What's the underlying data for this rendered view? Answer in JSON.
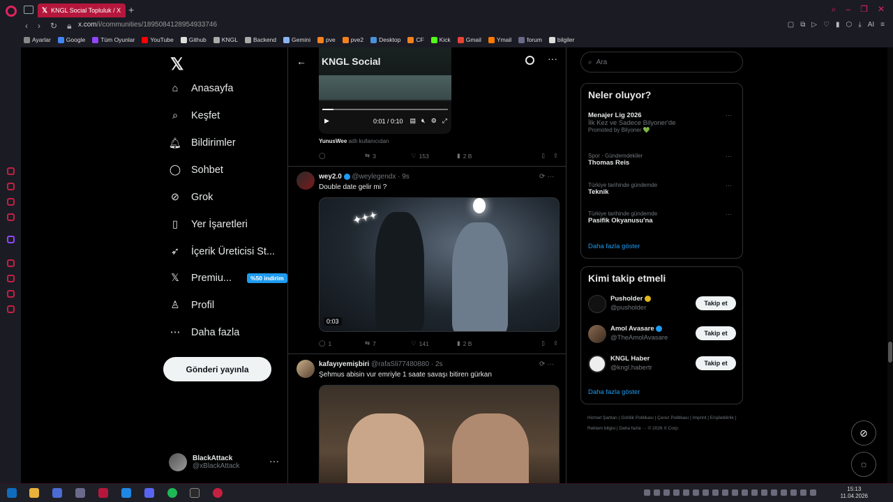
{
  "browser": {
    "tab_title": "KNGL Social Topluluk / X",
    "new_tab": "+",
    "url_host": "x.com",
    "url_path": "/i/communities/1895084128954933746",
    "bookmarks": [
      "Ayarlar",
      "Google",
      "Tüm Oyunlar",
      "YouTube",
      "Github",
      "KNGL",
      "Backend",
      "Gemini",
      "pve",
      "pve2",
      "Desktop",
      "CF",
      "Kick",
      "Gmail",
      "Ymail",
      "forum",
      "bilgiler"
    ],
    "ai_label": "AI"
  },
  "nav": {
    "items": [
      {
        "label": "Anasayfa",
        "icon": "home-icon"
      },
      {
        "label": "Keşfet",
        "icon": "search-icon"
      },
      {
        "label": "Bildirimler",
        "icon": "bell-icon"
      },
      {
        "label": "Sohbet",
        "icon": "chat-icon"
      },
      {
        "label": "Grok",
        "icon": "grok-icon"
      },
      {
        "label": "Yer İşaretleri",
        "icon": "bookmark-icon"
      },
      {
        "label": "İçerik Üreticisi St...",
        "icon": "rocket-icon"
      },
      {
        "label": "Premiu...",
        "icon": "x-logo-icon"
      },
      {
        "label": "Profil",
        "icon": "profile-icon"
      },
      {
        "label": "Daha fazla",
        "icon": "more-circle-icon"
      }
    ],
    "premium_badge": "%50 indirim",
    "post_button": "Gönderi yayınla",
    "account_name": "BlackAttack",
    "account_handle": "@xBlackAttack"
  },
  "feed": {
    "title": "KNGL Social",
    "first_video": {
      "time": "0:01 / 0:10",
      "note_user": "YunusWee",
      "note_text": "adlı kullanıcıdan"
    },
    "first_actions": {
      "replies": "",
      "reposts": "3",
      "likes": "153",
      "views": "2 B"
    },
    "tweets": [
      {
        "name": "wey2.0",
        "handle": "@weylegendx",
        "time": "9s",
        "text": "Double date gelir mi ?",
        "video_duration": "0:03",
        "replies": "1",
        "reposts": "7",
        "likes": "141",
        "views": "2 B"
      },
      {
        "name": "kafayıyemişbiri",
        "handle": "@rafaSli77480880",
        "time": "2s",
        "text": "Şehmus abisin vur emriyle 1 saate savaşı bitiren gürkan"
      }
    ]
  },
  "right": {
    "search_placeholder": "Ara",
    "trends_title": "Neler oluyor?",
    "trends": [
      {
        "category": "",
        "title": "Menajer Lig 2026",
        "subtitle": "İlk Kez ve Sadece Bilyoner'de",
        "promo": "Promoted by Bilyoner 💚"
      },
      {
        "category": "Spor · Gündemdekiler",
        "title": "Thomas Reis"
      },
      {
        "category": "Türkiye tarihinde gündemde",
        "title": "Teknik"
      },
      {
        "category": "Türkiye tarihinde gündemde",
        "title": "Pasifik Okyanusu'na"
      }
    ],
    "show_more": "Daha fazla göster",
    "follow_title": "Kimi takip etmeli",
    "follow": [
      {
        "name": "Pusholder",
        "handle": "@pusholder",
        "verified": "gold"
      },
      {
        "name": "Amol Avasare",
        "handle": "@TheAmolAvasare",
        "verified": "blue"
      },
      {
        "name": "KNGL Haber",
        "handle": "@kngl.habertr",
        "verified": ""
      }
    ],
    "follow_button": "Takip et",
    "footer": "Hizmet Şartları | Gizlilik Politikası | Çerez Politikası | Imprint | Erişilebilirlik | Reklam bilgisi | Daha fazla ··· © 2026 X Corp."
  },
  "taskbar": {
    "time": "15:13",
    "date": "11.04.2026"
  },
  "colors": {
    "accent": "#1d9bf0",
    "opera": "#e0245e",
    "tab": "#b5173c"
  }
}
